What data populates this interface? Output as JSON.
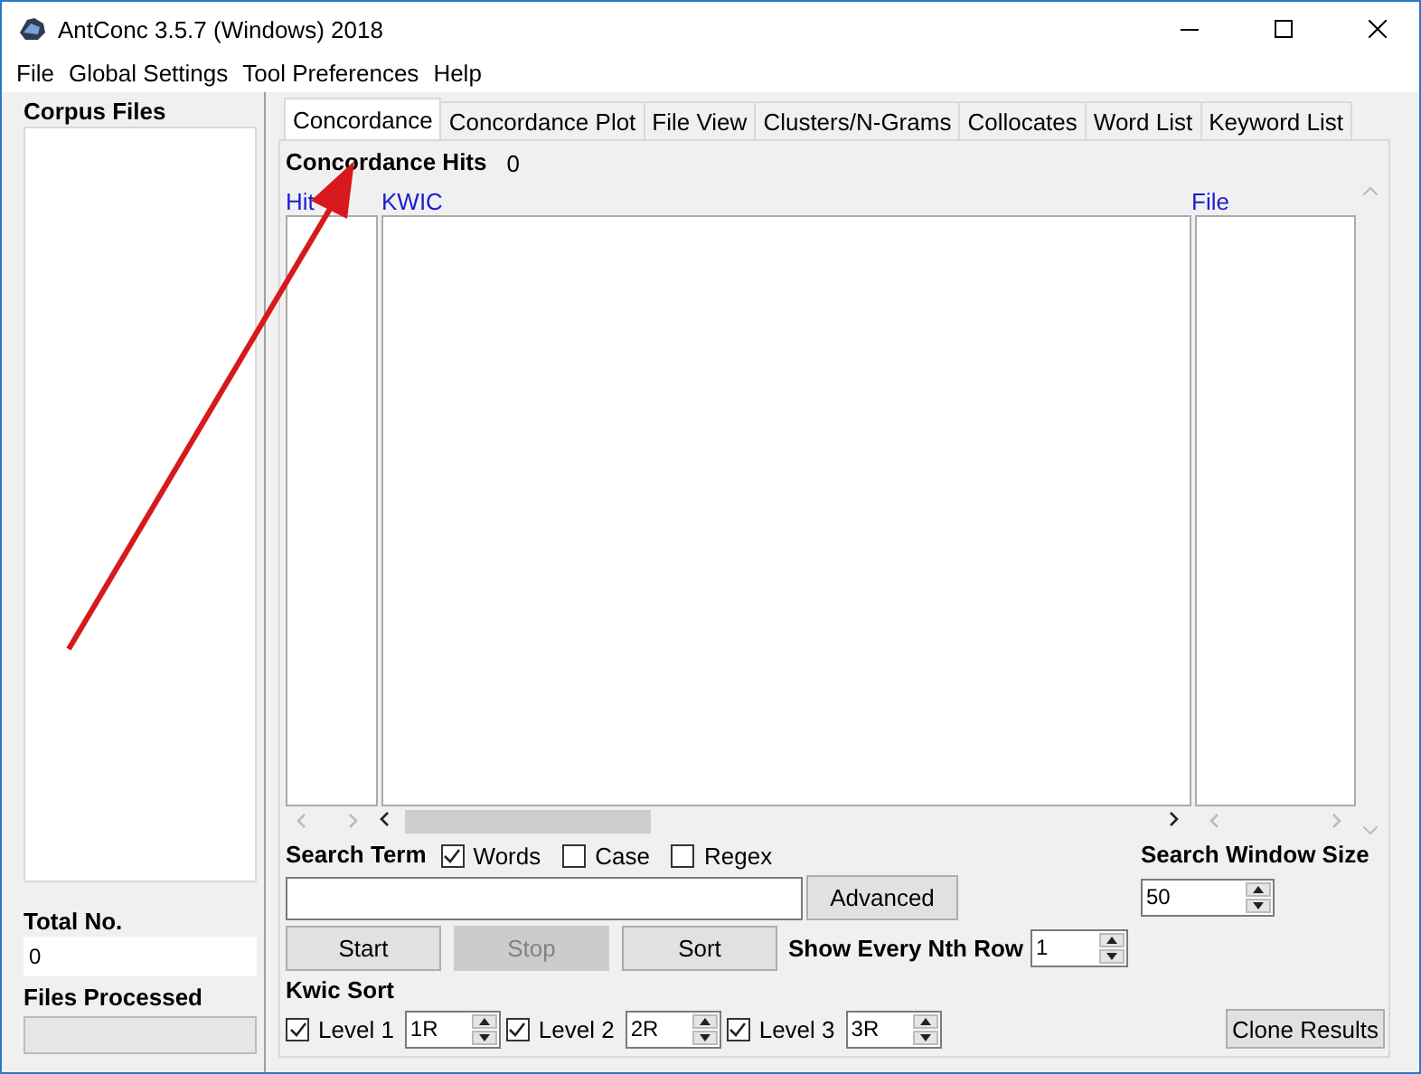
{
  "window": {
    "title": "AntConc 3.5.7 (Windows) 2018"
  },
  "menu": [
    "File",
    "Global Settings",
    "Tool Preferences",
    "Help"
  ],
  "sidebar": {
    "corpus_label": "Corpus Files",
    "total_label": "Total No.",
    "total_value": "0",
    "processed": {
      "label": "Files Processed",
      "level": 0
    }
  },
  "tabs": [
    {
      "label": "Concordance",
      "selected": true
    },
    {
      "label": "Concordance Plot",
      "selected": false
    },
    {
      "label": "File View",
      "selected": false
    },
    {
      "label": "Clusters/N-Grams",
      "selected": false
    },
    {
      "label": "Collocates",
      "selected": false
    },
    {
      "label": "Word List",
      "selected": false
    },
    {
      "label": "Keyword List",
      "selected": false
    }
  ],
  "hits": {
    "label": "Concordance Hits",
    "value": "0"
  },
  "columns": [
    "Hit",
    "KWIC",
    "File"
  ],
  "search": {
    "label": "Search Term",
    "options": [
      {
        "label": "Words",
        "checked": true
      },
      {
        "label": "Case",
        "checked": false
      },
      {
        "label": "Regex",
        "checked": false
      }
    ],
    "advanced": "Advanced"
  },
  "buttons": [
    {
      "label": "Start",
      "disabled": false
    },
    {
      "label": "Stop",
      "disabled": true
    },
    {
      "label": "Sort",
      "disabled": false
    }
  ],
  "show_every": {
    "label": "Show Every Nth Row",
    "value": "1"
  },
  "search_window": {
    "label": "Search Window Size",
    "value": "50"
  },
  "kwic_sort": {
    "label": "Kwic Sort",
    "levels": [
      {
        "label": "Level 1",
        "checked": true,
        "value": "1R"
      },
      {
        "label": "Level 2",
        "checked": true,
        "value": "2R"
      },
      {
        "label": "Level 3",
        "checked": true,
        "value": "3R"
      }
    ]
  },
  "clone_button": "Clone Results"
}
